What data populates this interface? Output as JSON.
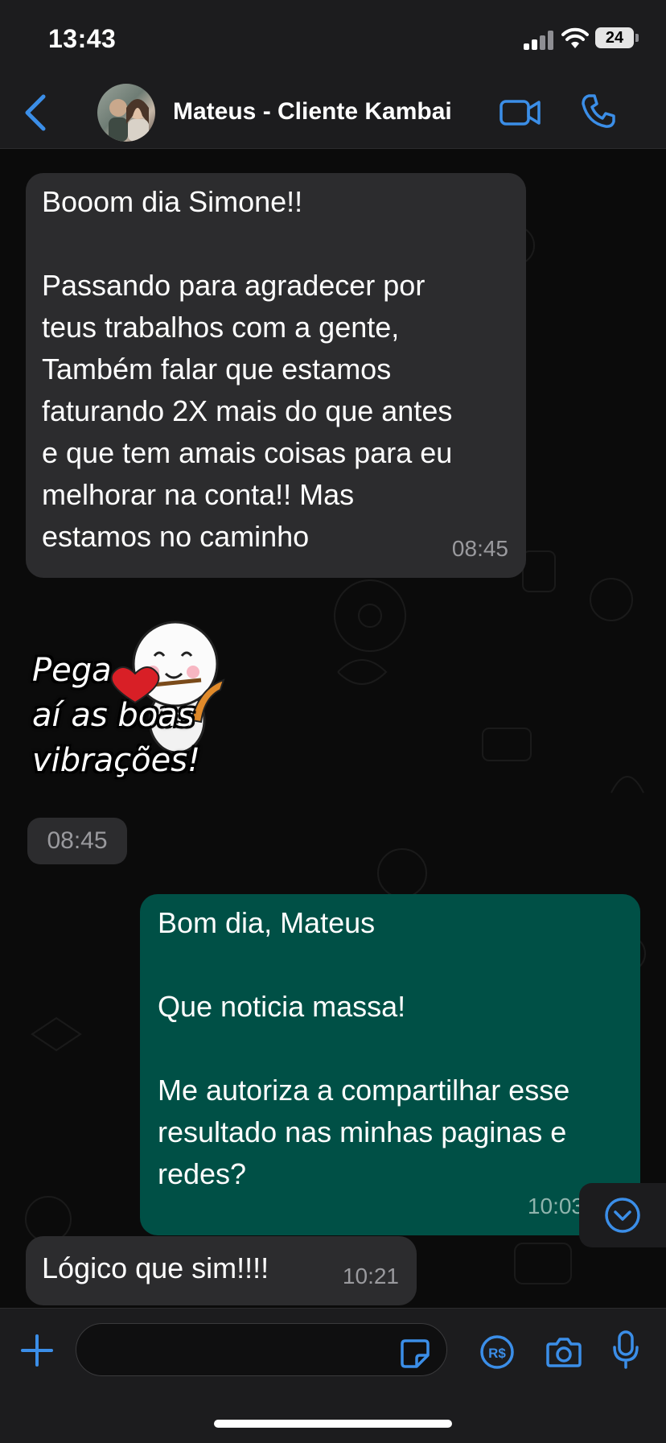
{
  "status_bar": {
    "time": "13:43",
    "battery": "24"
  },
  "header": {
    "contact_name": "Mateus - Cliente Kambai"
  },
  "messages": [
    {
      "direction": "incoming",
      "text": "Booom dia Simone!!\n\nPassando para agradecer por\nteus trabalhos com a gente,\nTambém falar que estamos\nfaturando 2X mais do que antes\ne que tem amais coisas para eu\nmelhorar na conta!! Mas\nestamos no caminho",
      "time": "08:45"
    },
    {
      "direction": "incoming",
      "type": "sticker",
      "text": "Pega\naí as boas\nvibrações!",
      "time": "08:45"
    },
    {
      "direction": "outgoing",
      "text": "Bom dia, Mateus\n\nQue noticia massa!\n\nMe autoriza a compartilhar esse\nresultado nas minhas paginas e\nredes?",
      "time": "10:03"
    },
    {
      "direction": "incoming",
      "text": "Lógico que sim!!!!",
      "time": "10:21"
    }
  ],
  "input": {
    "placeholder": ""
  },
  "colors": {
    "accent": "#3b8ee8",
    "incoming": "#2c2c2e",
    "outgoing": "#005046"
  }
}
